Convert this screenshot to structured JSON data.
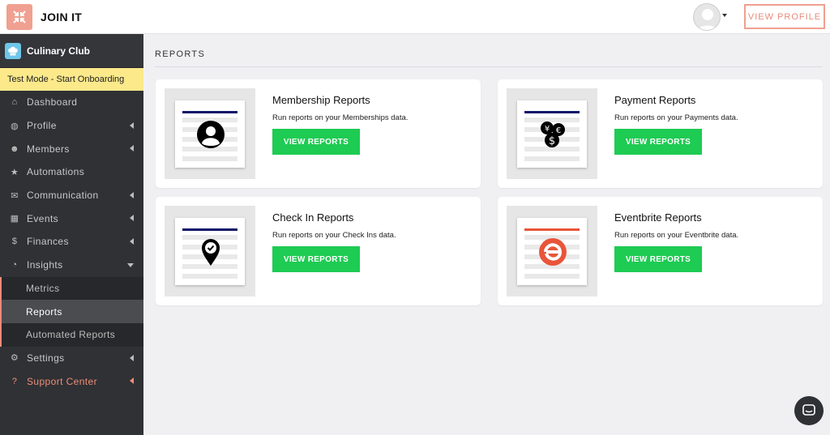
{
  "app": {
    "brand": "JOIN IT",
    "view_profile": "VIEW PROFILE"
  },
  "colors": {
    "accent": "#e98b78",
    "sidebar": "#2f3135",
    "cta": "#1ecb53",
    "test_mode": "#fbe98a"
  },
  "sidebar": {
    "club_name": "Culinary Club",
    "test_mode": "Test Mode - Start Onboarding",
    "items": [
      {
        "label": "Dashboard",
        "icon": "home-icon",
        "glyph": "⌂"
      },
      {
        "label": "Profile",
        "icon": "globe-icon",
        "glyph": "◍"
      },
      {
        "label": "Members",
        "icon": "users-icon",
        "glyph": "☻"
      },
      {
        "label": "Automations",
        "icon": "star-icon",
        "glyph": "★"
      },
      {
        "label": "Communication",
        "icon": "envelope-icon",
        "glyph": "✉"
      },
      {
        "label": "Events",
        "icon": "calendar-icon",
        "glyph": "▦"
      },
      {
        "label": "Finances",
        "icon": "dollar-icon",
        "glyph": "$"
      },
      {
        "label": "Insights",
        "icon": "pie-chart-icon",
        "glyph": "◔"
      }
    ],
    "insights_sub": [
      "Metrics",
      "Reports",
      "Automated Reports"
    ],
    "settings": {
      "label": "Settings",
      "icon": "gear-icon",
      "glyph": "⚙"
    },
    "support": {
      "label": "Support Center",
      "icon": "help-icon",
      "glyph": "?"
    }
  },
  "main": {
    "title": "REPORTS",
    "cards": [
      {
        "title": "Membership Reports",
        "desc": "Run reports on your Memberships data.",
        "button": "VIEW REPORTS",
        "icon": "user-circle-icon"
      },
      {
        "title": "Payment Reports",
        "desc": "Run reports on your Payments data.",
        "button": "VIEW REPORTS",
        "icon": "currency-coins-icon"
      },
      {
        "title": "Check In Reports",
        "desc": "Run reports on your Check Ins data.",
        "button": "VIEW REPORTS",
        "icon": "map-pin-check-icon"
      },
      {
        "title": "Eventbrite Reports",
        "desc": "Run reports on your Eventbrite data.",
        "button": "VIEW REPORTS",
        "icon": "eventbrite-logo-icon"
      }
    ]
  }
}
